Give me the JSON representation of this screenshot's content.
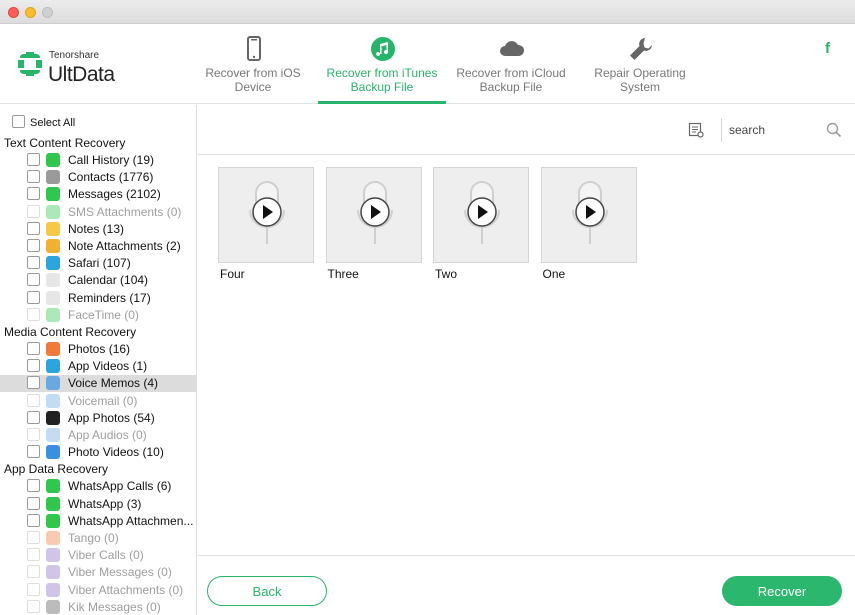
{
  "window": {
    "buttons": [
      "close",
      "minimize",
      "zoom"
    ]
  },
  "brand": {
    "small": "Tenorshare",
    "big": "UltData"
  },
  "tabs": [
    {
      "label_1": "Recover from iOS",
      "label_2": "Device",
      "icon": "iphone-icon",
      "active": false
    },
    {
      "label_1": "Recover from iTunes",
      "label_2": "Backup File",
      "icon": "itunes-icon",
      "active": true
    },
    {
      "label_1": "Recover from iCloud",
      "label_2": "Backup File",
      "icon": "cloud-icon",
      "active": false
    },
    {
      "label_1": "Repair Operating",
      "label_2": "System",
      "icon": "wrench-icon",
      "active": false
    }
  ],
  "social": {
    "facebook": "f"
  },
  "colors": {
    "accent": "#27b46b",
    "selected_row": "#dcdcdc"
  },
  "sidebar": {
    "select_all": "Select All",
    "sections": [
      {
        "title": "Text Content Recovery",
        "items": [
          {
            "label": "Call History (19)",
            "icon": "phone-icon",
            "color": "#2fc84d",
            "enabled": true
          },
          {
            "label": "Contacts (1776)",
            "icon": "contacts-icon",
            "color": "#9a9a9a",
            "enabled": true
          },
          {
            "label": "Messages (2102)",
            "icon": "messages-icon",
            "color": "#2fc84d",
            "enabled": true
          },
          {
            "label": "SMS Attachments (0)",
            "icon": "paperclip-icon",
            "color": "#2fc84d",
            "enabled": false
          },
          {
            "label": "Notes (13)",
            "icon": "notes-icon",
            "color": "#f5c945",
            "enabled": true
          },
          {
            "label": "Note Attachments (2)",
            "icon": "paperclip-icon",
            "color": "#f0b030",
            "enabled": true
          },
          {
            "label": "Safari (107)",
            "icon": "safari-icon",
            "color": "#2aa5de",
            "enabled": true
          },
          {
            "label": "Calendar (104)",
            "icon": "calendar-icon",
            "color": "#e6e6e6",
            "enabled": true
          },
          {
            "label": "Reminders (17)",
            "icon": "reminders-icon",
            "color": "#e6e6e6",
            "enabled": true
          },
          {
            "label": "FaceTime (0)",
            "icon": "facetime-icon",
            "color": "#2fc84d",
            "enabled": false
          }
        ]
      },
      {
        "title": "Media Content Recovery",
        "items": [
          {
            "label": "Photos (16)",
            "icon": "photos-icon",
            "color": "#f07a3a",
            "enabled": true
          },
          {
            "label": "App Videos (1)",
            "icon": "app-videos-icon",
            "color": "#2aa5de",
            "enabled": true
          },
          {
            "label": "Voice Memos (4)",
            "icon": "voice-memos-icon",
            "color": "#6aa8e0",
            "enabled": true,
            "selected": true
          },
          {
            "label": "Voicemail (0)",
            "icon": "voicemail-icon",
            "color": "#6aa8e0",
            "enabled": false
          },
          {
            "label": "App Photos (54)",
            "icon": "app-photos-icon",
            "color": "#222222",
            "enabled": true
          },
          {
            "label": "App Audios (0)",
            "icon": "app-audios-icon",
            "color": "#6aa8e0",
            "enabled": false
          },
          {
            "label": "Photo Videos (10)",
            "icon": "photo-videos-icon",
            "color": "#3b8fe0",
            "enabled": true
          }
        ]
      },
      {
        "title": "App Data Recovery",
        "items": [
          {
            "label": "WhatsApp Calls (6)",
            "icon": "whatsapp-calls-icon",
            "color": "#2fc84d",
            "enabled": true
          },
          {
            "label": "WhatsApp (3)",
            "icon": "whatsapp-icon",
            "color": "#2fc84d",
            "enabled": true
          },
          {
            "label": "WhatsApp Attachmen...",
            "icon": "whatsapp-attachment-icon",
            "color": "#2fc84d",
            "enabled": true
          },
          {
            "label": "Tango (0)",
            "icon": "tango-icon",
            "color": "#f07a3a",
            "enabled": false
          },
          {
            "label": "Viber Calls (0)",
            "icon": "viber-calls-icon",
            "color": "#8a6fc0",
            "enabled": false
          },
          {
            "label": "Viber Messages (0)",
            "icon": "viber-messages-icon",
            "color": "#8a6fc0",
            "enabled": false
          },
          {
            "label": "Viber Attachments (0)",
            "icon": "viber-attachment-icon",
            "color": "#8a6fc0",
            "enabled": false
          },
          {
            "label": "Kik Messages (0)",
            "icon": "kik-icon",
            "color": "#555555",
            "enabled": false
          }
        ]
      }
    ]
  },
  "search": {
    "placeholder": "search"
  },
  "memos": [
    {
      "name": "Four"
    },
    {
      "name": "Three"
    },
    {
      "name": "Two"
    },
    {
      "name": "One"
    }
  ],
  "buttons": {
    "back": "Back",
    "recover": "Recover"
  }
}
